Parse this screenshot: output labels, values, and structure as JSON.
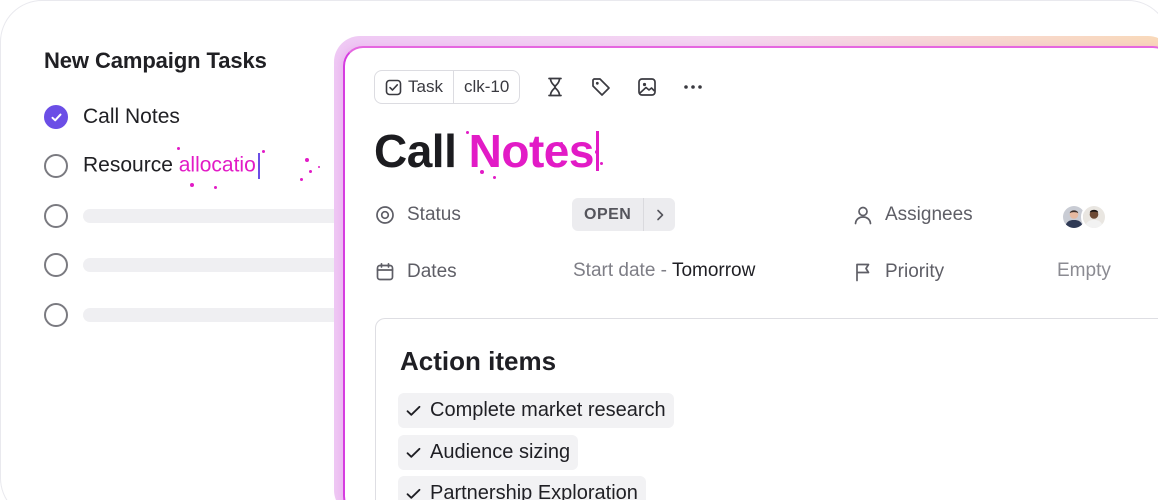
{
  "left": {
    "title": "New Campaign Tasks",
    "tasks": [
      {
        "label": "Call Notes",
        "checked": true
      },
      {
        "label_plain": "Resource ",
        "label_highlight": "allocatio",
        "checked": false
      }
    ]
  },
  "toolbar": {
    "task_label": "Task",
    "id_label": "clk-10",
    "icons": [
      "hourglass-icon",
      "tag-icon",
      "image-icon",
      "more-icon"
    ]
  },
  "task": {
    "title_plain": "Call ",
    "title_highlight": "Notes"
  },
  "fields": {
    "status_label": "Status",
    "status_value": "OPEN",
    "assignees_label": "Assignees",
    "dates_label": "Dates",
    "dates_prefix": "Start date - ",
    "dates_value": "Tomorrow",
    "priority_label": "Priority",
    "priority_value": "Empty"
  },
  "action_items": {
    "title": "Action items",
    "items": [
      "Complete market research",
      "Audience sizing",
      "Partnership Exploration"
    ]
  },
  "colors": {
    "accent_purple": "#6b4ee6",
    "highlight_pink": "#e21bc6"
  }
}
